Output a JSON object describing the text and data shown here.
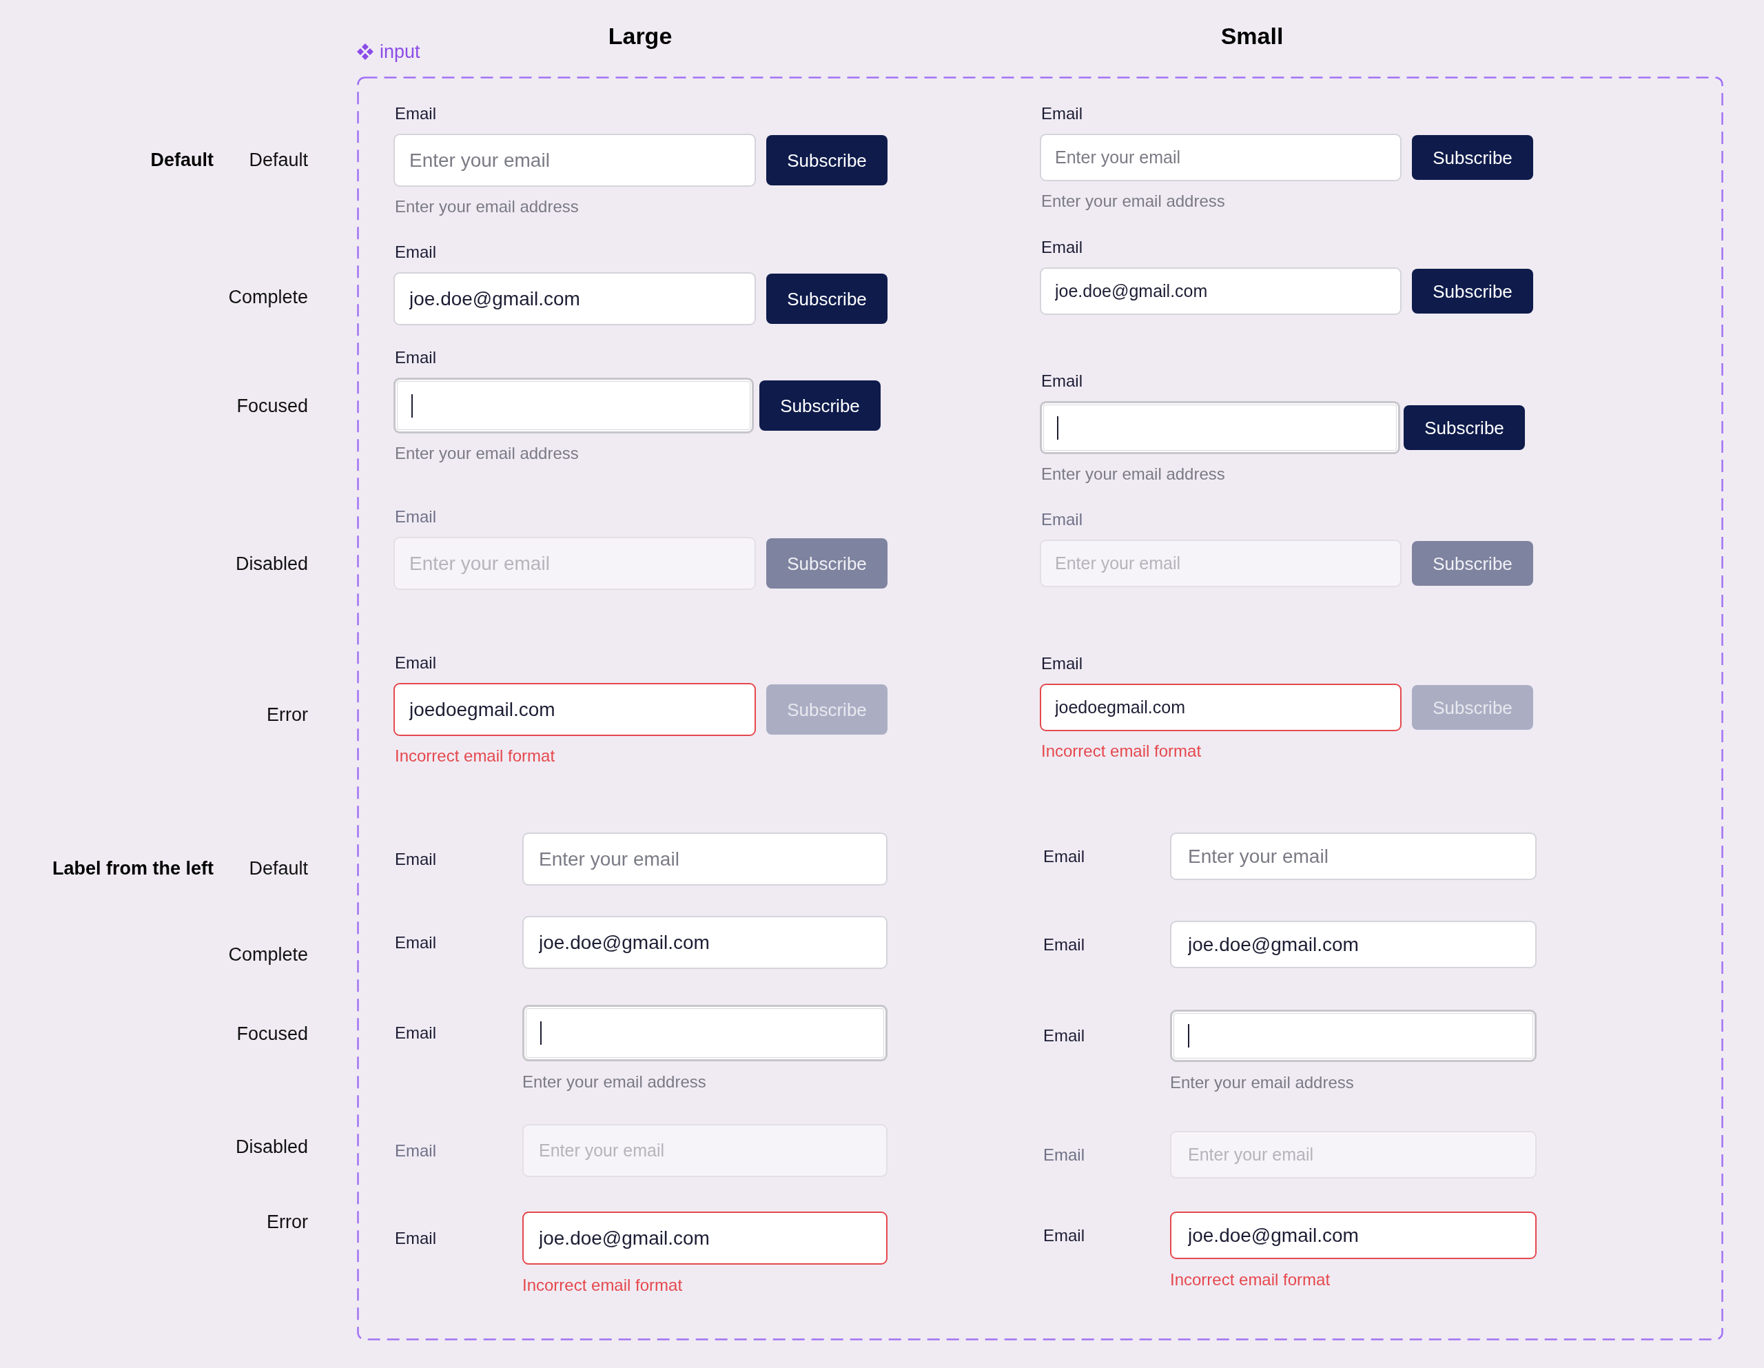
{
  "component_tag": {
    "label": "input"
  },
  "columns": [
    {
      "title": "Large"
    },
    {
      "title": "Small"
    }
  ],
  "sections": [
    {
      "title": "Default",
      "kind": "stacked",
      "rows": [
        {
          "state": "Default",
          "large": {
            "label": "Email",
            "placeholder": "Enter your email",
            "focused": false,
            "disabled": false,
            "error": false,
            "helper": "Enter your email address",
            "button": {
              "label": "Subscribe",
              "kind": "primary"
            }
          },
          "small": {
            "label": "Email",
            "placeholder": "Enter your email",
            "focused": false,
            "disabled": false,
            "error": false,
            "helper": "Enter your email address",
            "button": {
              "label": "Subscribe",
              "kind": "primary"
            }
          }
        },
        {
          "state": "Complete",
          "large": {
            "label": "Email",
            "value": "joe.doe@gmail.com",
            "focused": false,
            "disabled": false,
            "error": false,
            "button": {
              "label": "Subscribe",
              "kind": "primary"
            }
          },
          "small": {
            "label": "Email",
            "value": "joe.doe@gmail.com",
            "focused": false,
            "disabled": false,
            "error": false,
            "button": {
              "label": "Subscribe",
              "kind": "primary"
            }
          }
        },
        {
          "state": "Focused",
          "large": {
            "label": "Email",
            "focused": true,
            "disabled": false,
            "error": false,
            "helper": "Enter your email address",
            "button": {
              "label": "Subscribe",
              "kind": "primary"
            }
          },
          "small": {
            "label": "Email",
            "focused": true,
            "disabled": false,
            "error": false,
            "helper": "Enter your email address",
            "button": {
              "label": "Subscribe",
              "kind": "primary"
            }
          }
        },
        {
          "state": "Disabled",
          "large": {
            "label": "Email",
            "placeholder": "Enter your email",
            "focused": false,
            "disabled": true,
            "error": false,
            "button": {
              "label": "Subscribe",
              "kind": "disabled"
            }
          },
          "small": {
            "label": "Email",
            "placeholder": "Enter your email",
            "focused": false,
            "disabled": true,
            "error": false,
            "button": {
              "label": "Subscribe",
              "kind": "disabled"
            }
          }
        },
        {
          "state": "Error",
          "large": {
            "label": "Email",
            "value": "joedoegmail.com",
            "focused": false,
            "disabled": false,
            "error": true,
            "helper": "Incorrect email format",
            "button": {
              "label": "Subscribe",
              "kind": "inactive"
            }
          },
          "small": {
            "label": "Email",
            "value": "joedoegmail.com",
            "focused": false,
            "disabled": false,
            "error": true,
            "helper": "Incorrect email format",
            "button": {
              "label": "Subscribe",
              "kind": "inactive"
            }
          }
        }
      ]
    },
    {
      "title": "Label from the left",
      "kind": "inline",
      "rows": [
        {
          "state": "Default",
          "large": {
            "label": "Email",
            "placeholder": "Enter your email",
            "focused": false,
            "disabled": false,
            "error": false
          },
          "small": {
            "label": "Email",
            "placeholder": "Enter your email",
            "focused": false,
            "disabled": false,
            "error": false
          }
        },
        {
          "state": "Complete",
          "large": {
            "label": "Email",
            "value": "joe.doe@gmail.com",
            "focused": false,
            "disabled": false,
            "error": false
          },
          "small": {
            "label": "Email",
            "value": "joe.doe@gmail.com",
            "focused": false,
            "disabled": false,
            "error": false
          }
        },
        {
          "state": "Focused",
          "large": {
            "label": "Email",
            "focused": true,
            "disabled": false,
            "error": false,
            "helper": "Enter your email address"
          },
          "small": {
            "label": "Email",
            "focused": true,
            "disabled": false,
            "error": false,
            "helper": "Enter your email address"
          }
        },
        {
          "state": "Disabled",
          "large": {
            "label": "Email",
            "placeholder": "Enter your email",
            "focused": false,
            "disabled": true,
            "error": false
          },
          "small": {
            "label": "Email",
            "placeholder": "Enter your email",
            "focused": false,
            "disabled": true,
            "error": false
          }
        },
        {
          "state": "Error",
          "large": {
            "label": "Email",
            "value": "joe.doe@gmail.com",
            "focused": false,
            "disabled": false,
            "error": true,
            "helper": "Incorrect email format"
          },
          "small": {
            "label": "Email",
            "value": "joe.doe@gmail.com",
            "focused": false,
            "disabled": false,
            "error": true,
            "helper": "Incorrect email format"
          }
        }
      ]
    }
  ]
}
